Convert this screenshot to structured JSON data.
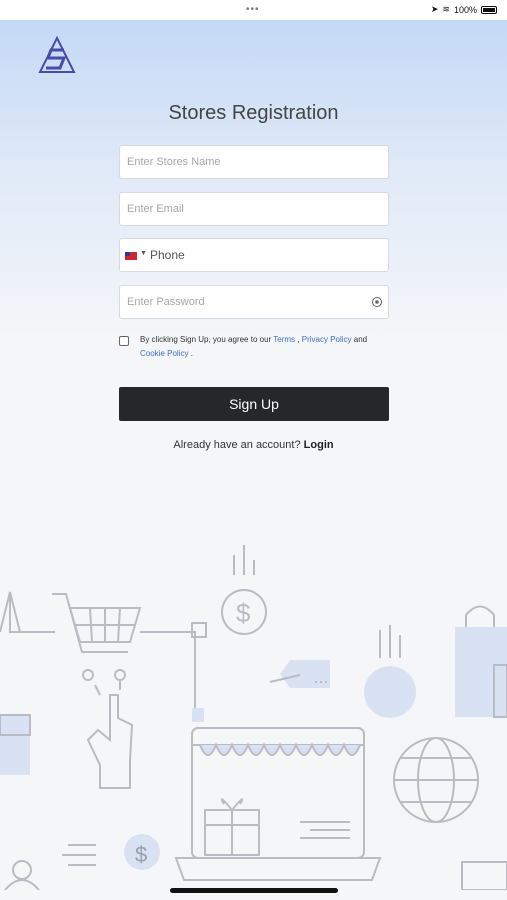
{
  "statusbar": {
    "dots": "•••",
    "battery": "100%"
  },
  "logo": {
    "name": "stores-logo"
  },
  "title": "Stores Registration",
  "form": {
    "store_name_placeholder": "Enter Stores Name",
    "email_placeholder": "Enter Email",
    "phone_placeholder": "Phone",
    "password_placeholder": "Enter Password"
  },
  "agreement": {
    "prefix": "By clicking Sign Up, you agree to our",
    "terms": "Terms",
    "comma": ",",
    "privacy": "Privacy Policy",
    "and": "and",
    "cookie": "Cookie Policy",
    "end": "."
  },
  "signup_label": "Sign Up",
  "footer": {
    "text": "Already have an account?",
    "login": "Login"
  },
  "colors": {
    "accent_link": "#3a6fd0",
    "button_bg": "#262729",
    "gradient_top": "#c4d9f5"
  }
}
